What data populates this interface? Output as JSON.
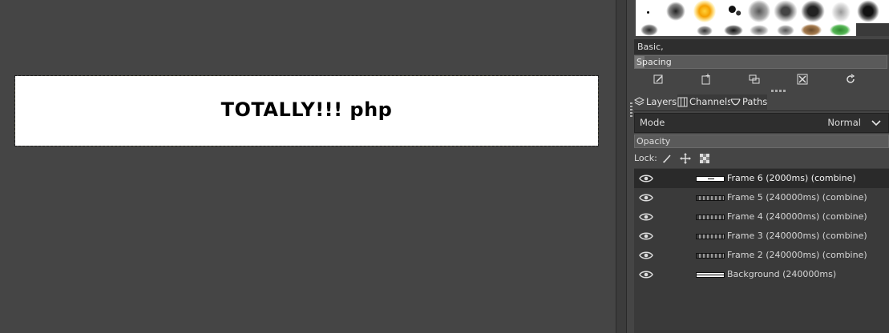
{
  "canvas": {
    "text": "TOTALLY!!! php"
  },
  "brushes": {
    "preset_filter": "Basic,",
    "spacing_label": "Spacing",
    "toolbar": [
      {
        "icon": "edit-brush-icon"
      },
      {
        "icon": "new-brush-icon"
      },
      {
        "icon": "duplicate-brush-icon"
      },
      {
        "icon": "delete-brush-icon"
      },
      {
        "icon": "refresh-brushes-icon"
      }
    ]
  },
  "tabs": [
    {
      "label": "Layers",
      "icon": "layers-icon",
      "active": true
    },
    {
      "label": "Channels",
      "icon": "channels-icon",
      "active": false
    },
    {
      "label": "Paths",
      "icon": "paths-icon",
      "active": false
    }
  ],
  "layers_panel": {
    "mode_label": "Mode",
    "mode_value": "Normal",
    "opacity_label": "Opacity",
    "lock_label": "Lock:",
    "lock_icons": [
      "lock-pixels-icon",
      "lock-position-icon",
      "lock-alpha-icon"
    ],
    "layers": [
      {
        "name": "Frame 6 (2000ms) (combine)",
        "visible": true,
        "selected": true
      },
      {
        "name": "Frame 5 (240000ms) (combine)",
        "visible": true,
        "selected": false
      },
      {
        "name": "Frame 4 (240000ms) (combine)",
        "visible": true,
        "selected": false
      },
      {
        "name": "Frame 3 (240000ms) (combine)",
        "visible": true,
        "selected": false
      },
      {
        "name": "Frame 2 (240000ms) (combine)",
        "visible": true,
        "selected": false
      },
      {
        "name": "Background (240000ms)",
        "visible": true,
        "selected": false
      }
    ]
  },
  "colors": {
    "background": "#454545",
    "selected_row": "#2a2a2a",
    "field": "#2e2e2e"
  }
}
